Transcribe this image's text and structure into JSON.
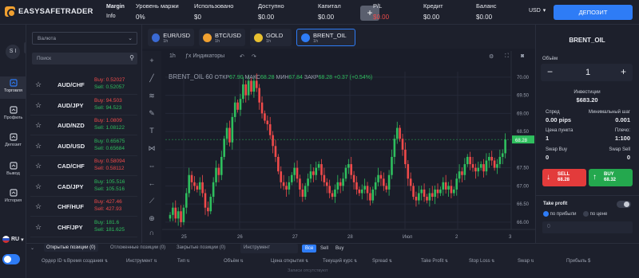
{
  "header": {
    "logo": "EASYSAFETRADER",
    "margin_info": [
      "Margin",
      "Info"
    ],
    "stats": [
      {
        "label": "Уровень маржи",
        "value": "0%",
        "color": "white"
      },
      {
        "label": "Использовано",
        "value": "$0",
        "color": "white"
      },
      {
        "label": "Доступно",
        "value": "$0.00",
        "color": "white"
      },
      {
        "label": "Капитал",
        "value": "$0.00",
        "color": "white"
      },
      {
        "label": "P/L",
        "value": "$0.00",
        "color": "red"
      },
      {
        "label": "Кредит",
        "value": "$0.00",
        "color": "white"
      },
      {
        "label": "Баланс",
        "value": "$0.00",
        "color": "white"
      }
    ],
    "currency": "USD",
    "deposit_button": "ДЕПОЗИТ"
  },
  "nav": {
    "avatar": "S I",
    "items": [
      {
        "label": "Торговля",
        "icon": "chart-icon",
        "active": true
      },
      {
        "label": "Профиль",
        "icon": "user-icon",
        "active": false
      },
      {
        "label": "Депозит",
        "icon": "wallet-icon",
        "active": false
      },
      {
        "label": "Вывод",
        "icon": "withdraw-icon",
        "active": false
      },
      {
        "label": "История",
        "icon": "history-icon",
        "active": false
      }
    ],
    "language": "RU"
  },
  "assets": {
    "select_label": "Валюта",
    "search_placeholder": "Поиск",
    "rows": [
      {
        "name": "AUD/CHF",
        "buy": "Buy: 0.52027",
        "sell": "Sell: 0.52057",
        "buy_color": "red",
        "sell_color": "green"
      },
      {
        "name": "AUD/JPY",
        "buy": "Buy: 94.503",
        "sell": "Sell: 94.523",
        "buy_color": "red",
        "sell_color": "green"
      },
      {
        "name": "AUD/NZD",
        "buy": "Buy: 1.0809",
        "sell": "Sell: 1.08122",
        "buy_color": "red",
        "sell_color": "green"
      },
      {
        "name": "AUD/USD",
        "buy": "Buy: 0.65675",
        "sell": "Sell: 0.65684",
        "buy_color": "green",
        "sell_color": "green"
      },
      {
        "name": "CAD/CHF",
        "buy": "Buy: 0.58094",
        "sell": "Sell: 0.58112",
        "buy_color": "red",
        "sell_color": "red"
      },
      {
        "name": "CAD/JPY",
        "buy": "Buy: 105.516",
        "sell": "Sell: 105.516",
        "buy_color": "green",
        "sell_color": "green"
      },
      {
        "name": "CHF/HUF",
        "buy": "Buy: 427.46",
        "sell": "Sell: 427.93",
        "buy_color": "red",
        "sell_color": "red"
      },
      {
        "name": "CHF/JPY",
        "buy": "Buy: 181.6",
        "sell": "Sell: 181.625",
        "buy_color": "green",
        "sell_color": "green"
      }
    ]
  },
  "tabs": [
    {
      "name": "EUR/USD",
      "tf": "1h",
      "icon_color": "#3a6ad4"
    },
    {
      "name": "BTC/USD",
      "tf": "1h",
      "icon_color": "#f0a030"
    },
    {
      "name": "GOLD",
      "tf": "1h",
      "icon_color": "#e8c030"
    },
    {
      "name": "BRENT_OIL",
      "tf": "1h",
      "icon_color": "#2e7cf6",
      "active": true
    }
  ],
  "chart_toolbar": {
    "indicators": "Индикаторы"
  },
  "chart_data": {
    "type": "candlestick",
    "symbol": "BRENT_OIL",
    "timeframe": "60",
    "ohlc_legend": {
      "open_label": "ОТКР",
      "open": "67.90",
      "high_label": "МАКС",
      "high": "68.28",
      "low_label": "МИН",
      "low": "67.84",
      "close_label": "ЗАКР",
      "close": "68.28",
      "change": "+0.37 (+0.54%)"
    },
    "y_ticks": [
      "70.00",
      "69.50",
      "69.00",
      "68.50",
      "68.28",
      "67.50",
      "67.00",
      "66.50",
      "66.00"
    ],
    "x_ticks": [
      "25",
      "26",
      "27",
      "28",
      "Июл",
      "2",
      "3"
    ],
    "ylim": [
      65.8,
      70.15
    ],
    "last_price": "68.28",
    "closes": [
      66.2,
      66.4,
      66.1,
      66.3,
      66.0,
      66.4,
      66.8,
      67.3,
      67.1,
      67.0,
      66.9,
      67.1,
      66.8,
      66.4,
      66.3,
      66.7,
      67.1,
      67.5,
      67.3,
      67.8,
      68.3,
      68.6,
      68.2,
      68.9,
      69.3,
      69.1,
      69.4,
      69.8,
      69.5,
      69.9,
      69.6,
      69.9,
      69.7,
      69.3,
      69.0,
      68.8,
      68.7,
      68.4,
      68.1,
      67.8,
      67.4,
      67.1,
      67.0,
      66.9,
      67.1,
      67.3,
      67.5,
      67.2,
      66.9,
      66.7,
      67.0,
      67.2,
      67.4,
      67.3,
      67.5,
      67.6,
      67.3,
      67.1,
      67.0,
      66.8,
      66.7,
      66.9,
      67.1,
      67.0,
      67.2,
      67.5,
      67.6,
      67.3,
      67.1,
      66.9,
      66.8,
      66.9,
      67.0,
      66.8,
      66.6,
      66.9,
      67.1,
      67.3,
      67.2,
      67.0,
      66.9,
      67.3,
      67.8,
      68.3,
      68.6,
      68.3,
      68.0,
      67.6,
      67.2,
      67.0,
      66.7,
      66.6,
      66.8,
      66.9,
      66.7,
      66.6,
      66.8,
      66.7,
      66.9,
      66.8,
      66.9,
      67.1,
      66.9,
      67.0,
      66.8,
      66.9,
      67.2,
      67.4,
      67.3,
      67.6,
      67.8,
      67.6,
      67.5,
      67.4,
      67.5,
      67.6,
      67.4,
      67.7,
      67.8,
      67.7,
      67.5,
      67.6,
      67.8,
      67.9,
      68.28
    ]
  },
  "panel": {
    "title": "BRENT_OIL",
    "volume_label": "Объём",
    "volume": "1",
    "investment_label": "Инвестиции",
    "investment": "$683.20",
    "spread_label": "Спред",
    "spread": "0.00 pips",
    "minstep_label": "Минимальный шаг",
    "minstep": "0.001",
    "pointprice_label": "Цена пункта",
    "pointprice": "1",
    "leverage_label": "Плечо:",
    "leverage": "1:100",
    "swapbuy_label": "Swap Buy",
    "swapbuy": "0",
    "swapsell_label": "Swap Sell",
    "swapsell": "0",
    "sell_label": "SELL",
    "sell_price": "68.28",
    "buy_label": "BUY",
    "buy_price": "68.32",
    "takeprofit_label": "Take profit",
    "opt_profit": "по прибыли",
    "opt_price": "по цене",
    "tp_value": "0"
  },
  "bottom": {
    "tab_open": "Открытые позиции (0)",
    "tab_pending": "Отложенные позиции (0)",
    "tab_closed": "Закрытые позиции (0)",
    "instrument_placeholder": "Инструмент",
    "filter_all": "Все",
    "filter_sell": "Sell",
    "filter_buy": "Buy",
    "columns": [
      "Ордер ID",
      "Время создания",
      "Инструмент",
      "Тип",
      "Объём",
      "Цена открытия",
      "Текущий курс",
      "Spread",
      "Take Profit",
      "Stop Loss",
      "Swap",
      "Прибыль $"
    ],
    "empty": "Записи отсутствуют"
  }
}
